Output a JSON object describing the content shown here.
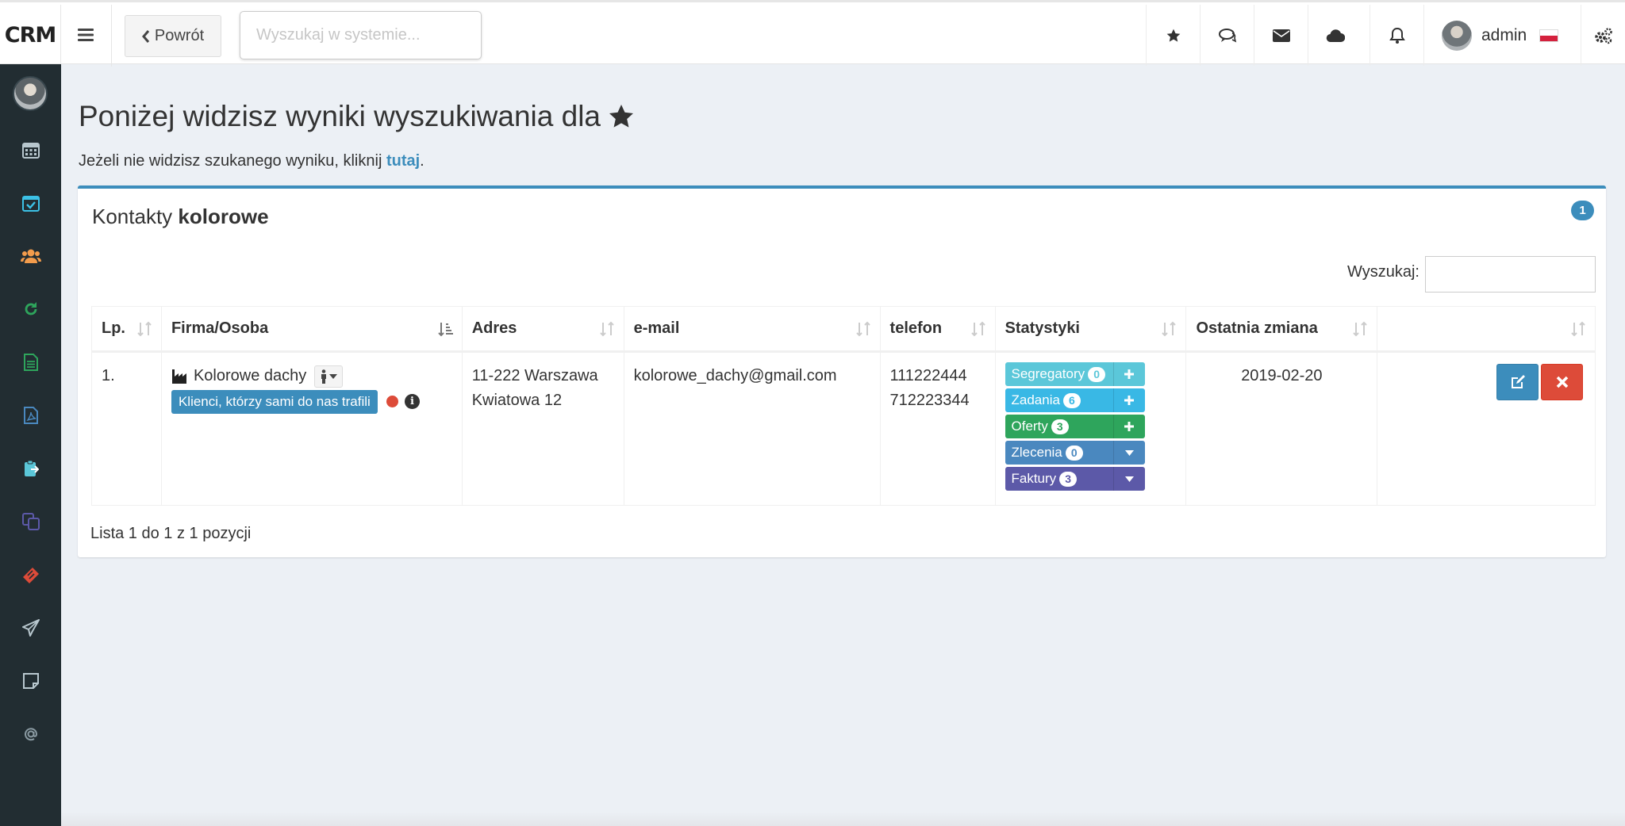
{
  "app": {
    "logo": "CRM"
  },
  "topbar": {
    "back_label": "Powrót",
    "search_placeholder": "Wyszukaj w systemie...",
    "icons": [
      "star-icon",
      "comments-icon",
      "envelope-icon",
      "cloud-icon",
      "bell-icon"
    ],
    "user_name": "admin"
  },
  "sidebar": {
    "icons": [
      "calendar-icon",
      "calendar-check-icon",
      "users-icon",
      "refresh-icon",
      "file-text-icon",
      "file-pdf-icon",
      "clipboard-icon",
      "copy-icon",
      "ticket-icon",
      "paper-plane-icon",
      "sticky-note-icon",
      "at-icon"
    ],
    "icon_colors": [
      "#b8c7ce",
      "#3cc1e6",
      "#f39c4c",
      "#2ea55c",
      "#2ea55c",
      "#4a88bf",
      "#5bc7d9",
      "#5c59a8",
      "#dd4b39",
      "#b8c7ce",
      "#b8c7ce",
      "#8a9aa2"
    ]
  },
  "page": {
    "heading": "Poniżej widzisz wyniki wyszukiwania dla",
    "sub_text": "Jeżeli nie widzisz szukanego wyniku, kliknij",
    "sub_link": "tutaj",
    "sub_end": "."
  },
  "results_box": {
    "title_prefix": "Kontakty",
    "title_keyword": "kolorowe",
    "count_badge": "1",
    "filter_label": "Wyszukaj:",
    "columns": [
      "Lp.",
      "Firma/Osoba",
      "Adres",
      "e-mail",
      "telefon",
      "Statystyki",
      "Ostatnia zmiana",
      ""
    ],
    "rows": [
      {
        "lp": "1.",
        "name": "Kolorowe dachy",
        "group": "Klienci, którzy sami do nas trafili",
        "address_line1": "11-222 Warszawa",
        "address_line2": "Kwiatowa 12",
        "email": "kolorowe_dachy@gmail.com",
        "phone1": "111222444",
        "phone2": "712223344",
        "stats": [
          {
            "label": "Segregatory",
            "count": "0",
            "action": "plus",
            "color": "#5bc7d9"
          },
          {
            "label": "Zadania",
            "count": "6",
            "action": "plus",
            "color": "#39b8e5"
          },
          {
            "label": "Oferty",
            "count": "3",
            "action": "plus",
            "color": "#2ea55c"
          },
          {
            "label": "Zlecenia",
            "count": "0",
            "action": "caret",
            "color": "#4a88bf"
          },
          {
            "label": "Faktury",
            "count": "3",
            "action": "caret",
            "color": "#5c59a8"
          }
        ],
        "last_change": "2019-02-20"
      }
    ],
    "info": "Lista 1 do 1 z 1 pozycji"
  },
  "colors": {
    "primary": "#3c8dbc",
    "danger": "#dd4b39",
    "sidebar": "#222d32",
    "background": "#ecf0f5"
  }
}
